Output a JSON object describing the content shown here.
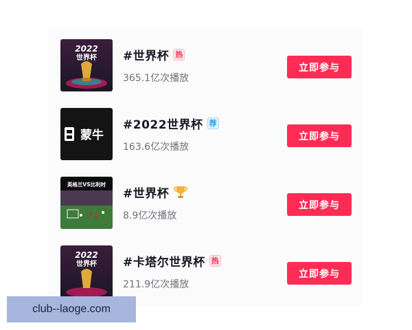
{
  "topics": [
    {
      "title": "#世界杯",
      "badge": "热",
      "badge_type": "hot",
      "plays": "365.1亿次播放",
      "thumb_text": [
        "2022",
        "世界杯"
      ],
      "button": "立即参与"
    },
    {
      "title": "#2022世界杯",
      "badge": "荐",
      "badge_type": "recommended",
      "plays": "163.6亿次播放",
      "thumb_text": [
        "蒙牛"
      ],
      "button": "立即参与"
    },
    {
      "title": "#世界杯",
      "badge_type": "trophy-icon",
      "plays": "8.9亿次播放",
      "thumb_text": [
        "英格兰VS比利时"
      ],
      "button": "立即参与"
    },
    {
      "title": "#卡塔尔世界杯",
      "badge": "热",
      "badge_type": "hot",
      "plays": "211.9亿次播放",
      "thumb_text": [
        "2022",
        "世界杯"
      ],
      "button": "立即参与"
    }
  ],
  "watermark": "club--laoge.com",
  "colors": {
    "accent": "#fe2c55",
    "hot_badge": "#fe2c55",
    "recommend_badge": "#2a9fe0",
    "title_text": "#161823",
    "meta_text": "#70727b",
    "watermark_bg": "#a7b6dd"
  }
}
